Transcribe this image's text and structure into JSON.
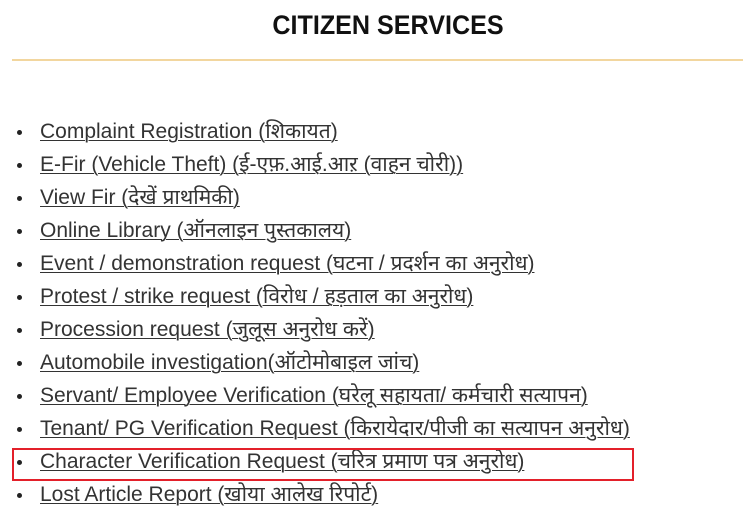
{
  "header": {
    "title": "CITIZEN SERVICES"
  },
  "colors": {
    "divider": "#f2d69e",
    "highlight_border": "#e3202a",
    "link_text": "#333333"
  },
  "services": [
    {
      "label": "Complaint Registration (शिकायत)"
    },
    {
      "label": "E-Fir (Vehicle Theft) (ई-एफ़.आई.आऱ (वाहन चोरी))"
    },
    {
      "label": "View Fir (देखें प्राथमिकी)"
    },
    {
      "label": "Online Library (ऑनलाइन पुस्तकालय)"
    },
    {
      "label": "Event / demonstration request (घटना / प्रदर्शन का अनुरोध)"
    },
    {
      "label": "Protest / strike request (विरोध / हड़ताल का अनुरोध)"
    },
    {
      "label": "Procession request (जुलूस अनुरोध करें)"
    },
    {
      "label": "Automobile investigation(ऑटोमोबाइल जांच)"
    },
    {
      "label": "Servant/ Employee Verification (घरेलू सहायता/ कर्मचारी सत्यापन)"
    },
    {
      "label": "Tenant/ PG Verification Request (किरायेदार/पीजी का सत्यापन अनुरोध)"
    },
    {
      "label": "Character Verification Request (चरित्र प्रमाण पत्र अनुरोध)",
      "highlighted": true
    },
    {
      "label": "Lost Article Report (खोया आलेख रिपोर्ट)"
    }
  ]
}
